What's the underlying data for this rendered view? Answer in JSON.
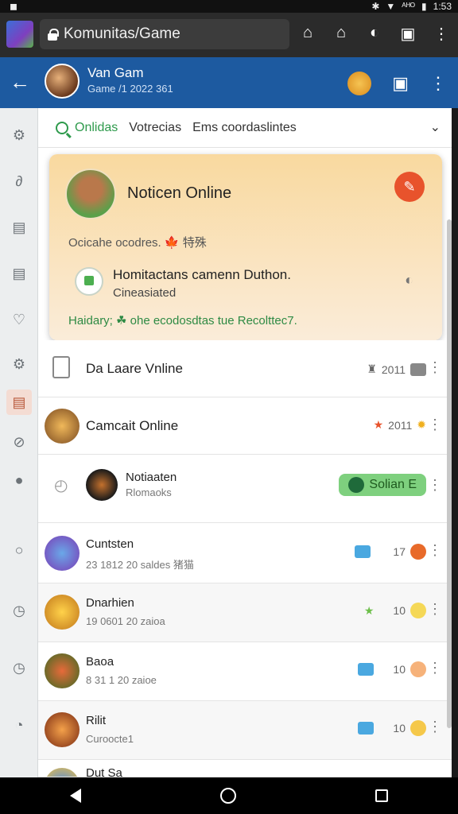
{
  "status_bar": {
    "time": "1:53",
    "network": "ᴬᴴᴼ"
  },
  "browser": {
    "url": "Komunitas/Game"
  },
  "header": {
    "name": "Van Gam",
    "subtitle": "Game /1 2022 361"
  },
  "tabs": [
    {
      "label": "Onlidas",
      "active": true
    },
    {
      "label": "Votrecias",
      "active": false
    },
    {
      "label": "Ems coordaslintes",
      "active": false
    }
  ],
  "notification": {
    "title": "Noticen Online",
    "line1": "Ocicahe ocodres. 🍁 特殊",
    "inner_title": "Homitactans camenn Duthon.",
    "inner_sub": "Cineasiated",
    "footer": "Haidary; ☘ ohe ecodosdtas tue Recolttec7."
  },
  "rows": [
    {
      "name": "Da Laare Vnline",
      "sub": "",
      "meta": "2011",
      "meta_color": "#8a8a8a"
    },
    {
      "name": "Camcait Online",
      "sub": "",
      "meta": "2011",
      "meta_color": "#e8532c"
    },
    {
      "name": "Notiaaten",
      "sub": "Rlomaoks",
      "pill": "Solian E"
    },
    {
      "name": "Cuntsten",
      "sub": "23 1812 20 saldes 猪猫",
      "meta": "17",
      "meta_color": "#888"
    },
    {
      "name": "Dnarhien",
      "sub": "19 0601 20 zaioa",
      "meta": "10",
      "meta_color": "#888"
    },
    {
      "name": "Baoa",
      "sub": "8 31 1 20 zaioe",
      "meta": "10",
      "meta_color": "#888"
    },
    {
      "name": "Rilit",
      "sub": "Curoocte1",
      "meta": "10",
      "meta_color": "#888"
    },
    {
      "name": "Dut Sa",
      "sub": ""
    }
  ],
  "colors": {
    "brand": "#1d5aa0",
    "accent": "#2e9a4c",
    "alert": "#e8532c"
  }
}
